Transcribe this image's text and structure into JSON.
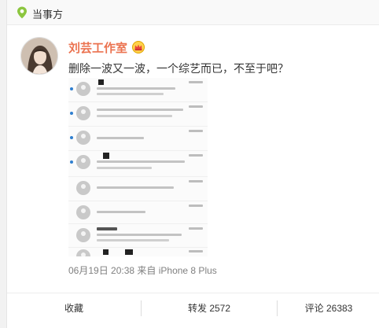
{
  "header": {
    "title": "当事方",
    "icon": "location-pin-icon",
    "accent": "#8cc63f"
  },
  "post": {
    "username": "刘芸工作室",
    "badge_icon": "crown-icon",
    "username_color": "#eb7350",
    "text": "删除一波又一波，一个综艺而已，不至于吧？",
    "image_alt": "screenshot of a list of deleted comment notifications",
    "meta": "06月19日 20:38  来自 iPhone 8 Plus"
  },
  "actions": {
    "favorite": "收藏",
    "repost": "转发 2572",
    "comment": "评论 26383"
  }
}
